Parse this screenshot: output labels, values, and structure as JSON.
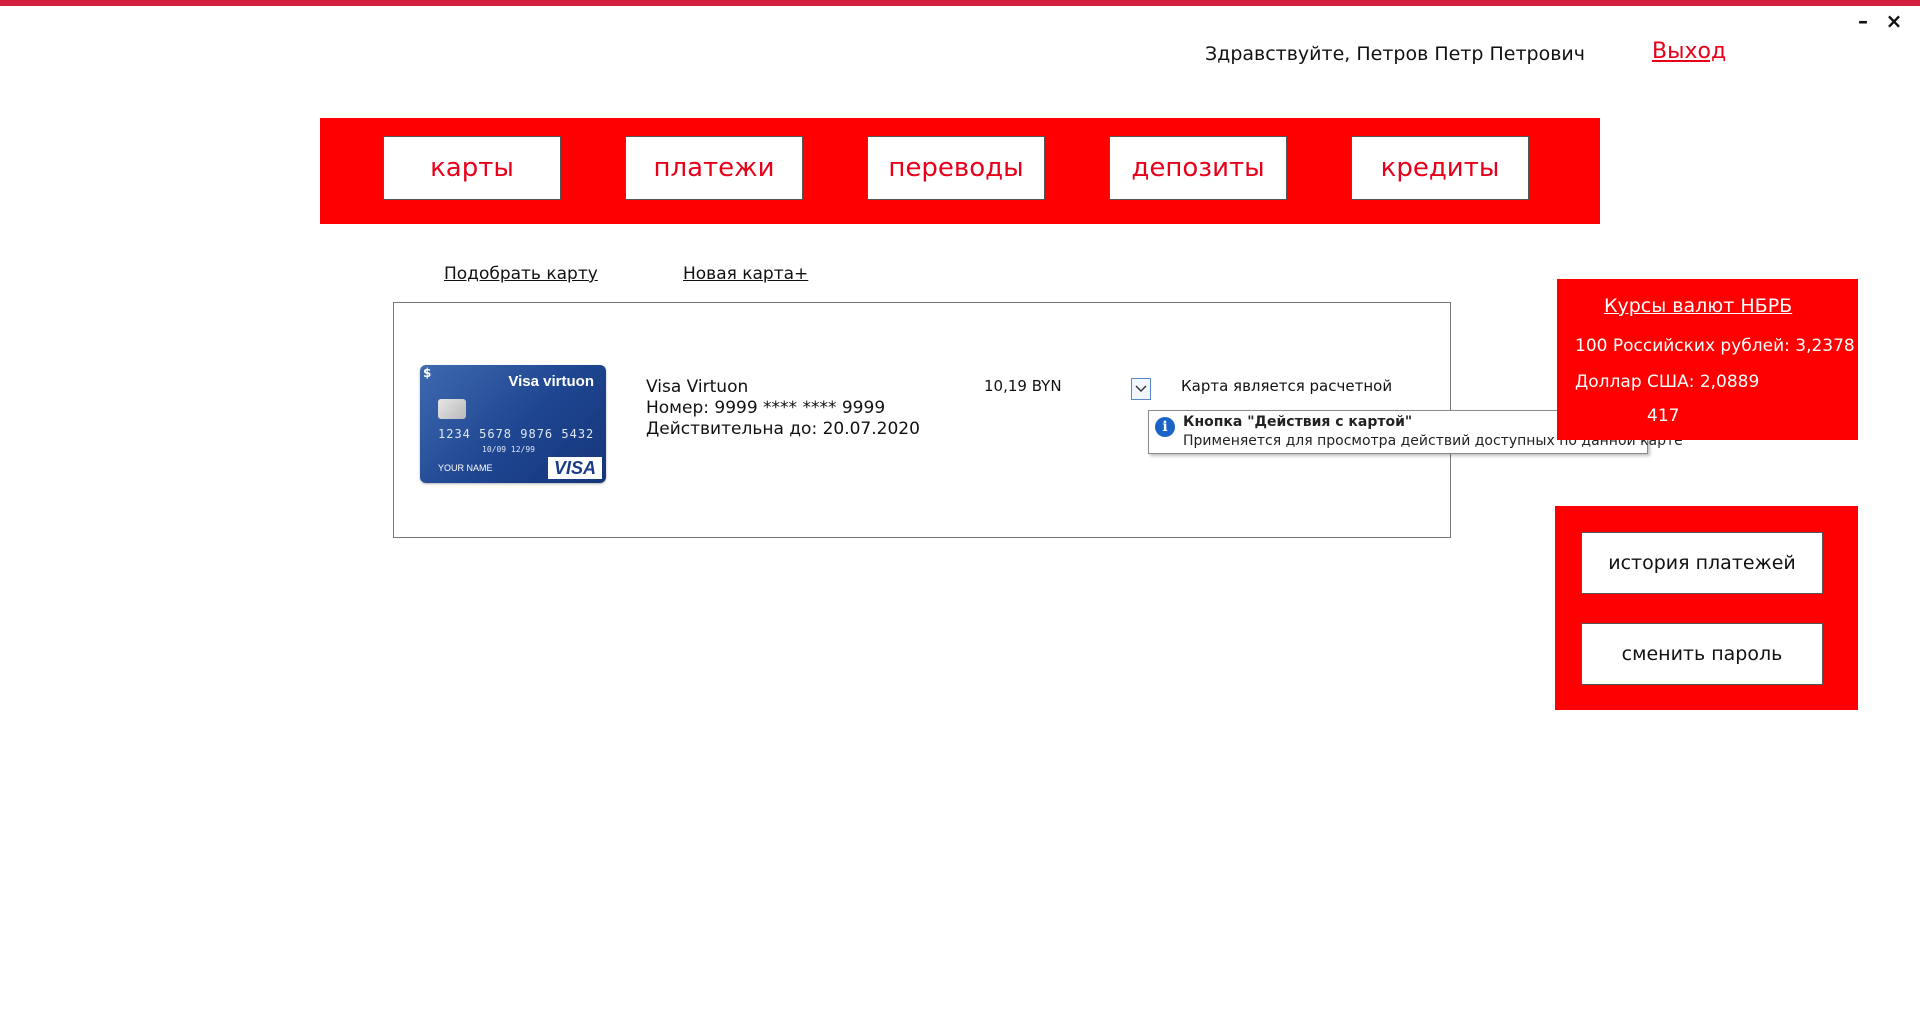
{
  "window": {
    "minimize_label": "–",
    "close_label": "×"
  },
  "header": {
    "greeting": "Здравствуйте, Петров Петр Петрович",
    "logout_label": "Выход"
  },
  "nav": {
    "items": [
      {
        "label": "карты"
      },
      {
        "label": "платежи"
      },
      {
        "label": "переводы"
      },
      {
        "label": "депозиты"
      },
      {
        "label": "кредиты"
      }
    ]
  },
  "links": {
    "pick_card": "Подобрать карту",
    "new_card": "Новая карта+"
  },
  "card": {
    "image": {
      "brand_title": "Visa virtuon",
      "dollar": "$",
      "number": "1234 5678 9876 5432",
      "valid": "10/09 12/99",
      "holder": "YOUR NAME",
      "logo": "VISA"
    },
    "name": "Visa Virtuon",
    "number_line": "Номер: 9999 **** **** 9999",
    "valid_line": "Действительна до: 20.07.2020",
    "balance": "10,19 BYN",
    "status": "Карта является расчетной",
    "actions_icon": "chevron-down-icon"
  },
  "tooltip": {
    "icon": "i",
    "title": "Кнопка \"Действия с картой\"",
    "text": "Применяется для просмотра действий доступных по данной карте"
  },
  "rates": {
    "title": "Курсы валют НБРБ",
    "lines": [
      "100 Российских рублей: 3,2378",
      "Доллар США: 2,0889",
      "417"
    ]
  },
  "side": {
    "history_label": "история платежей",
    "password_label": "сменить пароль"
  },
  "colors": {
    "accent_red": "#ff0000",
    "text_red": "#e8001b",
    "top_stripe": "#d3203f"
  }
}
